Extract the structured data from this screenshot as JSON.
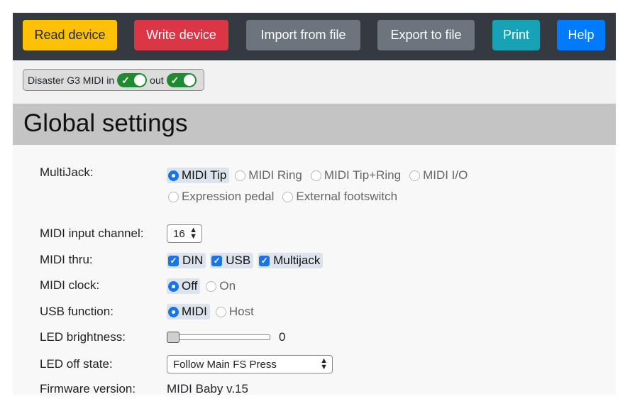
{
  "toolbar": {
    "read": "Read device",
    "write": "Write device",
    "import": "Import from file",
    "export": "Export to file",
    "print": "Print",
    "help": "Help"
  },
  "device": {
    "name": "Disaster G3 MIDI",
    "in_label": "in",
    "out_label": "out",
    "in_enabled": true,
    "out_enabled": true
  },
  "section": {
    "title": "Global settings"
  },
  "settings": {
    "multijack": {
      "label": "MultiJack:",
      "options": [
        "MIDI Tip",
        "MIDI Ring",
        "MIDI Tip+Ring",
        "MIDI I/O",
        "Expression pedal",
        "External footswitch"
      ],
      "selected": "MIDI Tip"
    },
    "midi_input_channel": {
      "label": "MIDI input channel:",
      "value": "16"
    },
    "midi_thru": {
      "label": "MIDI thru:",
      "options": [
        "DIN",
        "USB",
        "Multijack"
      ],
      "checked": [
        true,
        true,
        true
      ]
    },
    "midi_clock": {
      "label": "MIDI clock:",
      "options": [
        "Off",
        "On"
      ],
      "selected": "Off"
    },
    "usb_function": {
      "label": "USB function:",
      "options": [
        "MIDI",
        "Host"
      ],
      "selected": "MIDI"
    },
    "led_brightness": {
      "label": "LED brightness:",
      "value": "0"
    },
    "led_off_state": {
      "label": "LED off state:",
      "value": "Follow Main FS Press"
    },
    "firmware_version": {
      "label": "Firmware version:",
      "value": "MIDI Baby v.15"
    }
  },
  "colors": {
    "read": "#ffc107",
    "write": "#dc3545",
    "secondary": "#6c757d",
    "print": "#17a2b8",
    "help": "#007bff",
    "toggle_on": "#1f8a2f",
    "accent": "#1a73e8",
    "toolbar_bg": "#343a40"
  }
}
